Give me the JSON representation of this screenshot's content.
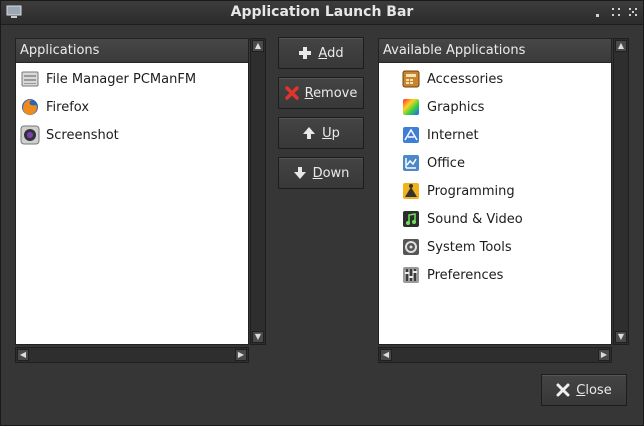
{
  "window": {
    "title": "Application Launch Bar"
  },
  "left_panel": {
    "header": "Applications",
    "items": [
      {
        "label": "File Manager PCManFM",
        "icon": "file-manager-icon"
      },
      {
        "label": "Firefox",
        "icon": "firefox-icon"
      },
      {
        "label": "Screenshot",
        "icon": "screenshot-icon"
      }
    ]
  },
  "right_panel": {
    "header": "Available Applications",
    "items": [
      {
        "label": "Accessories",
        "icon": "accessories-icon"
      },
      {
        "label": "Graphics",
        "icon": "graphics-icon"
      },
      {
        "label": "Internet",
        "icon": "internet-icon"
      },
      {
        "label": "Office",
        "icon": "office-icon"
      },
      {
        "label": "Programming",
        "icon": "programming-icon"
      },
      {
        "label": "Sound & Video",
        "icon": "sound-video-icon"
      },
      {
        "label": "System Tools",
        "icon": "system-tools-icon"
      },
      {
        "label": "Preferences",
        "icon": "preferences-icon"
      }
    ]
  },
  "buttons": {
    "add": {
      "mnemonic": "A",
      "rest": "dd"
    },
    "remove": {
      "mnemonic": "R",
      "rest": "emove"
    },
    "up": {
      "mnemonic": "U",
      "rest": "p"
    },
    "down": {
      "mnemonic": "D",
      "rest": "own"
    },
    "close": {
      "mnemonic": "C",
      "rest": "lose"
    }
  }
}
